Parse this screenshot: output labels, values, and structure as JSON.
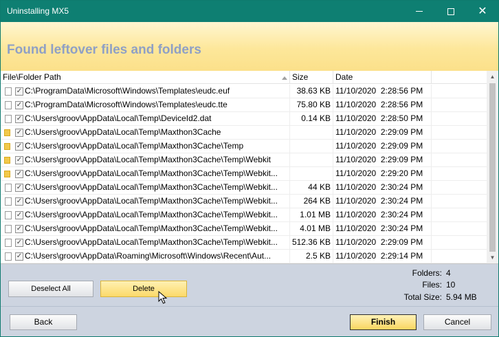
{
  "window": {
    "title": "Uninstalling MX5"
  },
  "banner": {
    "heading": "Found leftover files and folders"
  },
  "table": {
    "columns": [
      "File\\Folder Path",
      "Size",
      "Date"
    ],
    "rows": [
      {
        "type": "file",
        "checked": true,
        "path": "C:\\ProgramData\\Microsoft\\Windows\\Templates\\eudc.euf",
        "size": "38.63 KB",
        "date": "11/10/2020",
        "time": "2:28:56 PM"
      },
      {
        "type": "file",
        "checked": true,
        "path": "C:\\ProgramData\\Microsoft\\Windows\\Templates\\eudc.tte",
        "size": "75.80 KB",
        "date": "11/10/2020",
        "time": "2:28:56 PM"
      },
      {
        "type": "file",
        "checked": true,
        "path": "C:\\Users\\groov\\AppData\\Local\\Temp\\DeviceId2.dat",
        "size": "0.14 KB",
        "date": "11/10/2020",
        "time": "2:28:50 PM"
      },
      {
        "type": "folder",
        "checked": true,
        "path": "C:\\Users\\groov\\AppData\\Local\\Temp\\Maxthon3Cache",
        "size": "",
        "date": "11/10/2020",
        "time": "2:29:09 PM"
      },
      {
        "type": "folder",
        "checked": true,
        "path": "C:\\Users\\groov\\AppData\\Local\\Temp\\Maxthon3Cache\\Temp",
        "size": "",
        "date": "11/10/2020",
        "time": "2:29:09 PM"
      },
      {
        "type": "folder",
        "checked": true,
        "path": "C:\\Users\\groov\\AppData\\Local\\Temp\\Maxthon3Cache\\Temp\\Webkit",
        "size": "",
        "date": "11/10/2020",
        "time": "2:29:09 PM"
      },
      {
        "type": "folder",
        "checked": true,
        "path": "C:\\Users\\groov\\AppData\\Local\\Temp\\Maxthon3Cache\\Temp\\Webkit...",
        "size": "",
        "date": "11/10/2020",
        "time": "2:29:20 PM"
      },
      {
        "type": "file",
        "checked": true,
        "path": "C:\\Users\\groov\\AppData\\Local\\Temp\\Maxthon3Cache\\Temp\\Webkit...",
        "size": "44 KB",
        "date": "11/10/2020",
        "time": "2:30:24 PM"
      },
      {
        "type": "file",
        "checked": true,
        "path": "C:\\Users\\groov\\AppData\\Local\\Temp\\Maxthon3Cache\\Temp\\Webkit...",
        "size": "264 KB",
        "date": "11/10/2020",
        "time": "2:30:24 PM"
      },
      {
        "type": "file",
        "checked": true,
        "path": "C:\\Users\\groov\\AppData\\Local\\Temp\\Maxthon3Cache\\Temp\\Webkit...",
        "size": "1.01 MB",
        "date": "11/10/2020",
        "time": "2:30:24 PM"
      },
      {
        "type": "file",
        "checked": true,
        "path": "C:\\Users\\groov\\AppData\\Local\\Temp\\Maxthon3Cache\\Temp\\Webkit...",
        "size": "4.01 MB",
        "date": "11/10/2020",
        "time": "2:30:24 PM"
      },
      {
        "type": "file",
        "checked": true,
        "path": "C:\\Users\\groov\\AppData\\Local\\Temp\\Maxthon3Cache\\Temp\\Webkit...",
        "size": "512.36 KB",
        "date": "11/10/2020",
        "time": "2:29:09 PM"
      },
      {
        "type": "file",
        "checked": true,
        "path": "C:\\Users\\groov\\AppData\\Roaming\\Microsoft\\Windows\\Recent\\Aut...",
        "size": "2.5 KB",
        "date": "11/10/2020",
        "time": "2:29:14 PM"
      }
    ]
  },
  "actions": {
    "deselect_all": "Deselect All",
    "delete": "Delete"
  },
  "stats": {
    "folders_label": "Folders:",
    "folders_value": "4",
    "files_label": "Files:",
    "files_value": "10",
    "total_label": "Total Size:",
    "total_value": "5.94 MB"
  },
  "nav": {
    "back": "Back",
    "finish": "Finish",
    "cancel": "Cancel"
  },
  "colors": {
    "titlebar": "#0e7f72",
    "heading": "#8fa0c5",
    "panel": "#cdd4e0"
  }
}
